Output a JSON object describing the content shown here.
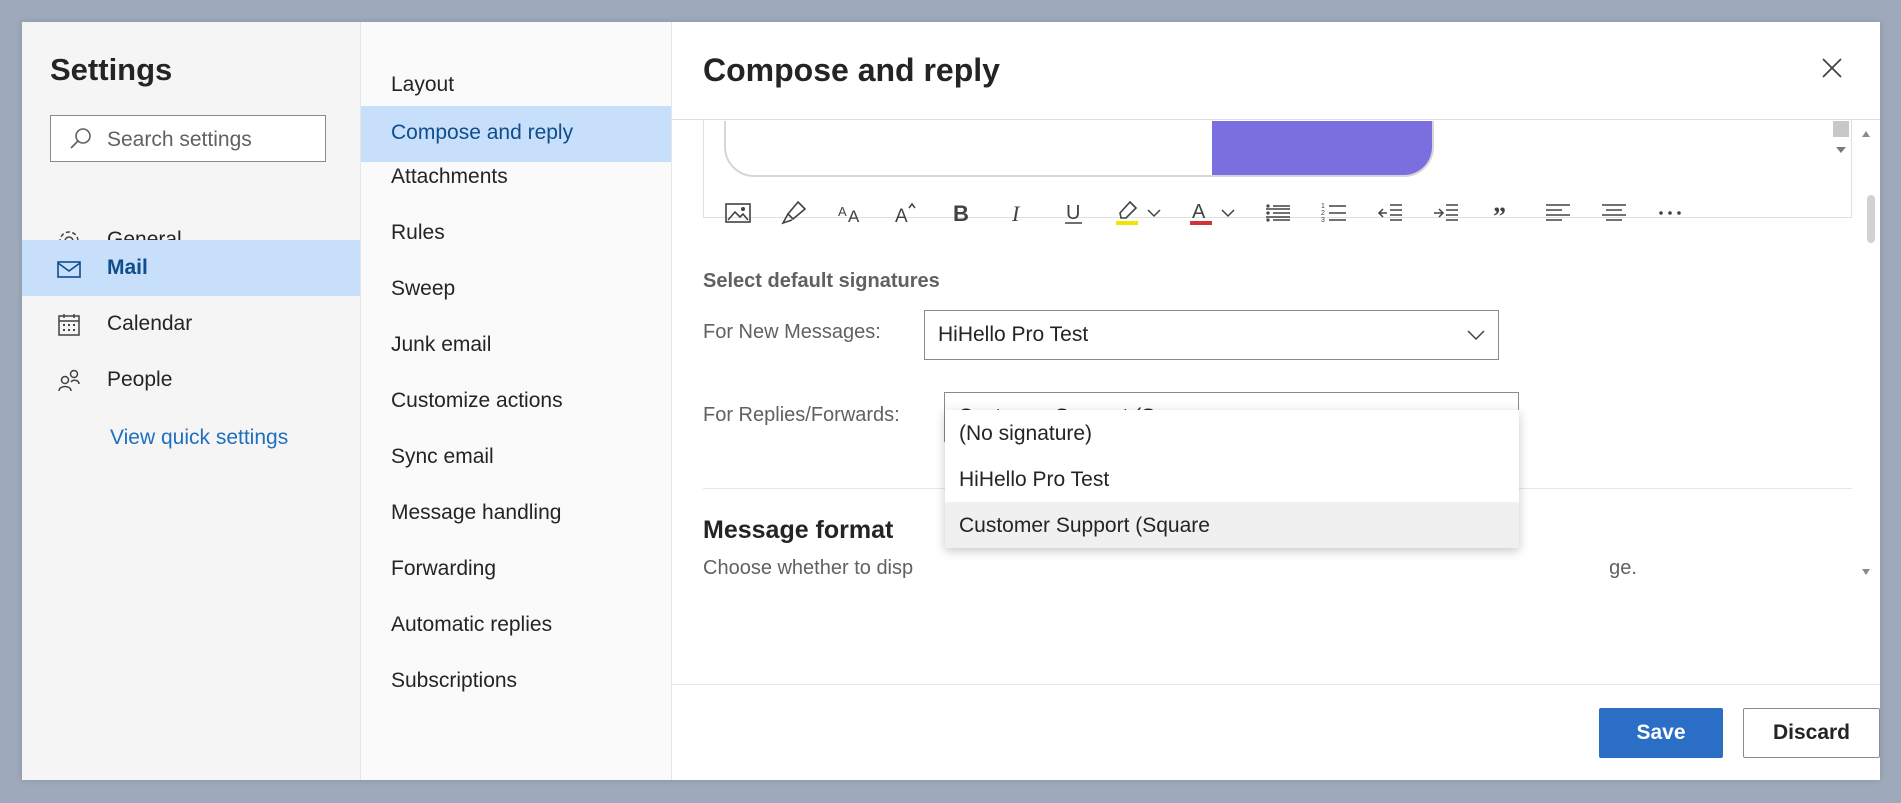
{
  "settings": {
    "title": "Settings",
    "search_placeholder": "Search settings",
    "nav": [
      {
        "label": "General",
        "icon": "gear-icon"
      },
      {
        "label": "Mail",
        "icon": "mail-icon",
        "active": true
      },
      {
        "label": "Calendar",
        "icon": "calendar-icon"
      },
      {
        "label": "People",
        "icon": "people-icon"
      }
    ],
    "view_quick_settings": "View quick settings"
  },
  "submenu": [
    {
      "label": "Layout"
    },
    {
      "label": "Compose and reply",
      "active": true
    },
    {
      "label": "Attachments"
    },
    {
      "label": "Rules"
    },
    {
      "label": "Sweep"
    },
    {
      "label": "Junk email"
    },
    {
      "label": "Customize actions"
    },
    {
      "label": "Sync email"
    },
    {
      "label": "Message handling"
    },
    {
      "label": "Forwarding"
    },
    {
      "label": "Automatic replies"
    },
    {
      "label": "Subscriptions"
    }
  ],
  "panel": {
    "title": "Compose and reply",
    "toolbar_icons": [
      "insert-image-icon",
      "format-painter-icon",
      "font-size-icon",
      "grow-font-icon",
      "bold-icon",
      "italic-icon",
      "underline-icon",
      "highlight-icon",
      "font-color-icon",
      "bullets-icon",
      "numbering-icon",
      "decrease-indent-icon",
      "increase-indent-icon",
      "quote-icon",
      "align-left-icon",
      "align-center-icon",
      "more-options-icon"
    ],
    "signatures": {
      "heading": "Select default signatures",
      "new_messages_label": "For New Messages:",
      "new_messages_value": "HiHello Pro Test",
      "replies_label": "For Replies/Forwards:",
      "replies_value": "Customer Support (Square",
      "options": [
        "(No signature)",
        "HiHello Pro Test",
        "Customer Support (Square"
      ]
    },
    "message_format": {
      "title": "Message format",
      "desc_start": "Choose whether to disp",
      "desc_end": "ge."
    },
    "save_label": "Save",
    "discard_label": "Discard"
  },
  "colors": {
    "accent": "#2b6ec5",
    "selected_bg": "#c7dffa",
    "signature_button": "#7b6fe0"
  }
}
